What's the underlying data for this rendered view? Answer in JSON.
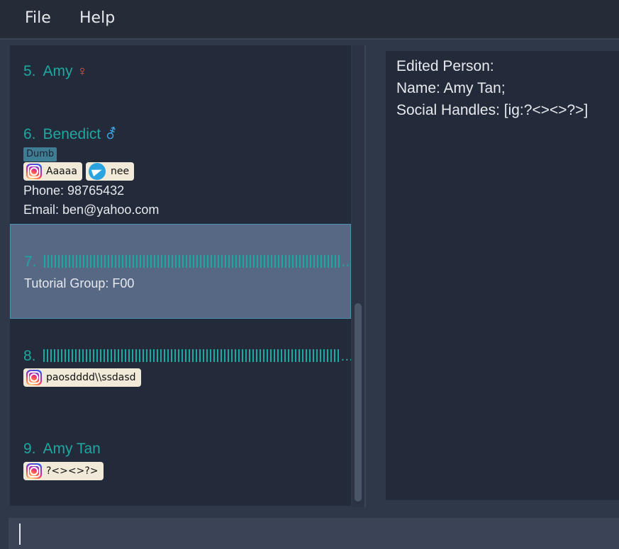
{
  "menu": {
    "file": "File",
    "help": "Help"
  },
  "persons": [
    {
      "index": "5.",
      "name": "Amy",
      "gender_symbol": "♀"
    },
    {
      "index": "6.",
      "name": "Benedict",
      "gender_symbol": "⚦",
      "tag": "Dumb",
      "handles": [
        {
          "platform": "instagram",
          "icon": "instagram-icon",
          "value": "Aaaaa"
        },
        {
          "platform": "telegram",
          "icon": "telegram-icon",
          "value": "nee"
        }
      ],
      "phone": "Phone: 98765432",
      "email": "Email: ben@yahoo.com"
    },
    {
      "index": "7.",
      "name_ellipsis": "...",
      "tutorial_group": "Tutorial Group: F00"
    },
    {
      "index": "8.",
      "name_ellipsis": "...",
      "handles": [
        {
          "platform": "instagram",
          "icon": "instagram-icon",
          "value": "paosdddd\\\\ssdasd"
        }
      ]
    },
    {
      "index": "9.",
      "name": "Amy Tan",
      "handles": [
        {
          "platform": "instagram",
          "icon": "instagram-icon",
          "value": "?<><>?>"
        }
      ]
    }
  ],
  "result": {
    "line1": "Edited Person:",
    "line2": "Name: Amy Tan;",
    "line3": "Social Handles: [ig:?<><>?>]"
  },
  "command": {
    "value": ""
  },
  "colors": {
    "accent": "#1fa7a1",
    "female": "#e05a4a",
    "male": "#3aa6e8",
    "selected": "#566884"
  }
}
